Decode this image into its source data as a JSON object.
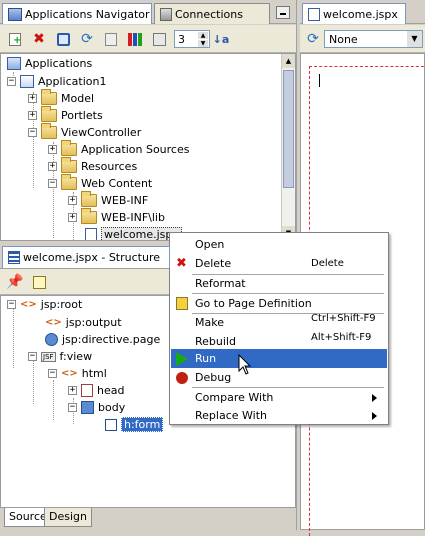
{
  "navigator": {
    "tabs": [
      "Applications Navigator",
      "Connections"
    ],
    "spinner_value": "3",
    "tree": {
      "root": "Applications",
      "app": "Application1",
      "items": [
        "Model",
        "Portlets",
        "ViewController",
        "Application Sources",
        "Resources",
        "Web Content",
        "WEB-INF",
        "WEB-INF\\lib",
        "welcome.jspx"
      ]
    }
  },
  "editor": {
    "tab": "welcome.jspx",
    "select_value": "None"
  },
  "structure": {
    "title": "welcome.jspx - Structure",
    "nodes": [
      "jsp:root",
      "jsp:output",
      "jsp:directive.page",
      "f:view",
      "html",
      "head",
      "body",
      "h:form"
    ],
    "bottom_tabs": [
      "Source",
      "Design"
    ]
  },
  "context_menu": {
    "items": [
      {
        "label": "Open",
        "shortcut": ""
      },
      {
        "label": "Delete",
        "shortcut": "Delete"
      },
      {
        "label": "Reformat",
        "shortcut": ""
      },
      {
        "label": "Go to Page Definition",
        "shortcut": ""
      },
      {
        "label": "Make",
        "shortcut": "Ctrl+Shift-F9"
      },
      {
        "label": "Rebuild",
        "shortcut": "Alt+Shift-F9"
      },
      {
        "label": "Run",
        "shortcut": ""
      },
      {
        "label": "Debug",
        "shortcut": ""
      },
      {
        "label": "Compare With",
        "shortcut": ""
      },
      {
        "label": "Replace With",
        "shortcut": ""
      }
    ]
  },
  "colors": {
    "selection": "#316ac5",
    "accent_red": "#d01010",
    "run_green": "#18a818"
  }
}
